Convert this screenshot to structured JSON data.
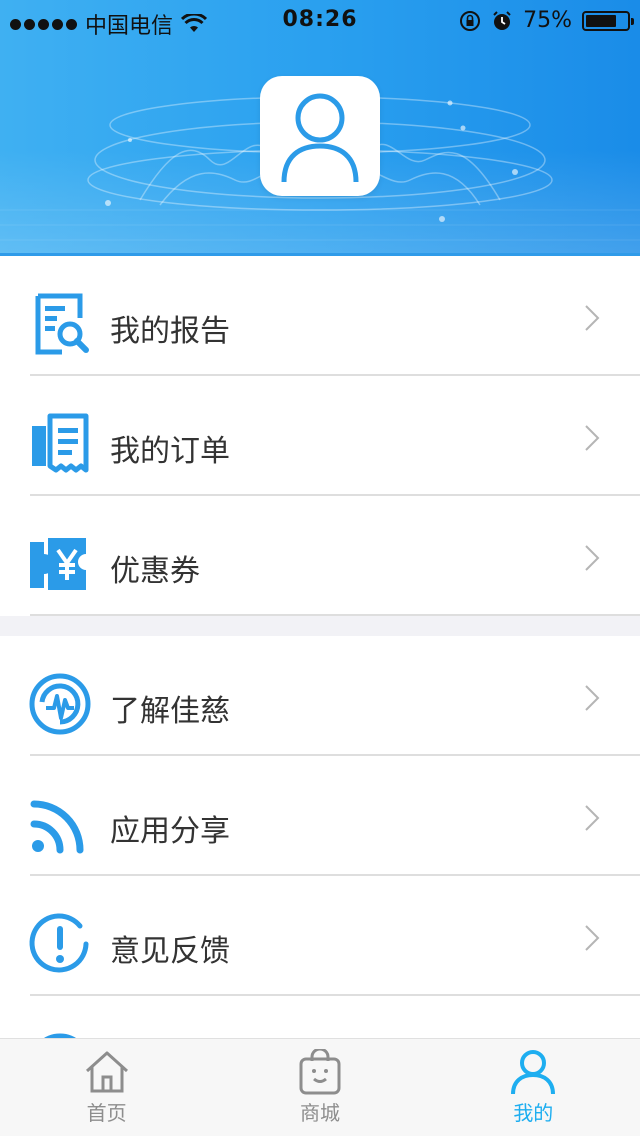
{
  "status_bar": {
    "carrier": "中国电信",
    "time": "08:26",
    "battery": "75%",
    "battery_level": 0.75
  },
  "profile": {
    "avatar_icon": "user-avatar-icon"
  },
  "menu": {
    "group1": [
      {
        "label": "我的报告",
        "icon": "report-search-icon"
      },
      {
        "label": "我的订单",
        "icon": "order-receipt-icon"
      },
      {
        "label": "优惠券",
        "icon": "coupon-yen-icon"
      }
    ],
    "group2": [
      {
        "label": "了解佳慈",
        "icon": "about-logo-icon"
      },
      {
        "label": "应用分享",
        "icon": "share-rss-icon"
      },
      {
        "label": "意见反馈",
        "icon": "feedback-exclamation-icon"
      }
    ]
  },
  "tab_bar": {
    "tabs": [
      {
        "label": "首页",
        "icon": "home-icon",
        "active": false
      },
      {
        "label": "商城",
        "icon": "shopping-bag-icon",
        "active": false
      },
      {
        "label": "我的",
        "icon": "profile-icon",
        "active": true
      }
    ]
  },
  "colors": {
    "accent": "#1eaef0",
    "header_blue": "#2aa0ef",
    "icon_blue": "#2b9be8"
  }
}
